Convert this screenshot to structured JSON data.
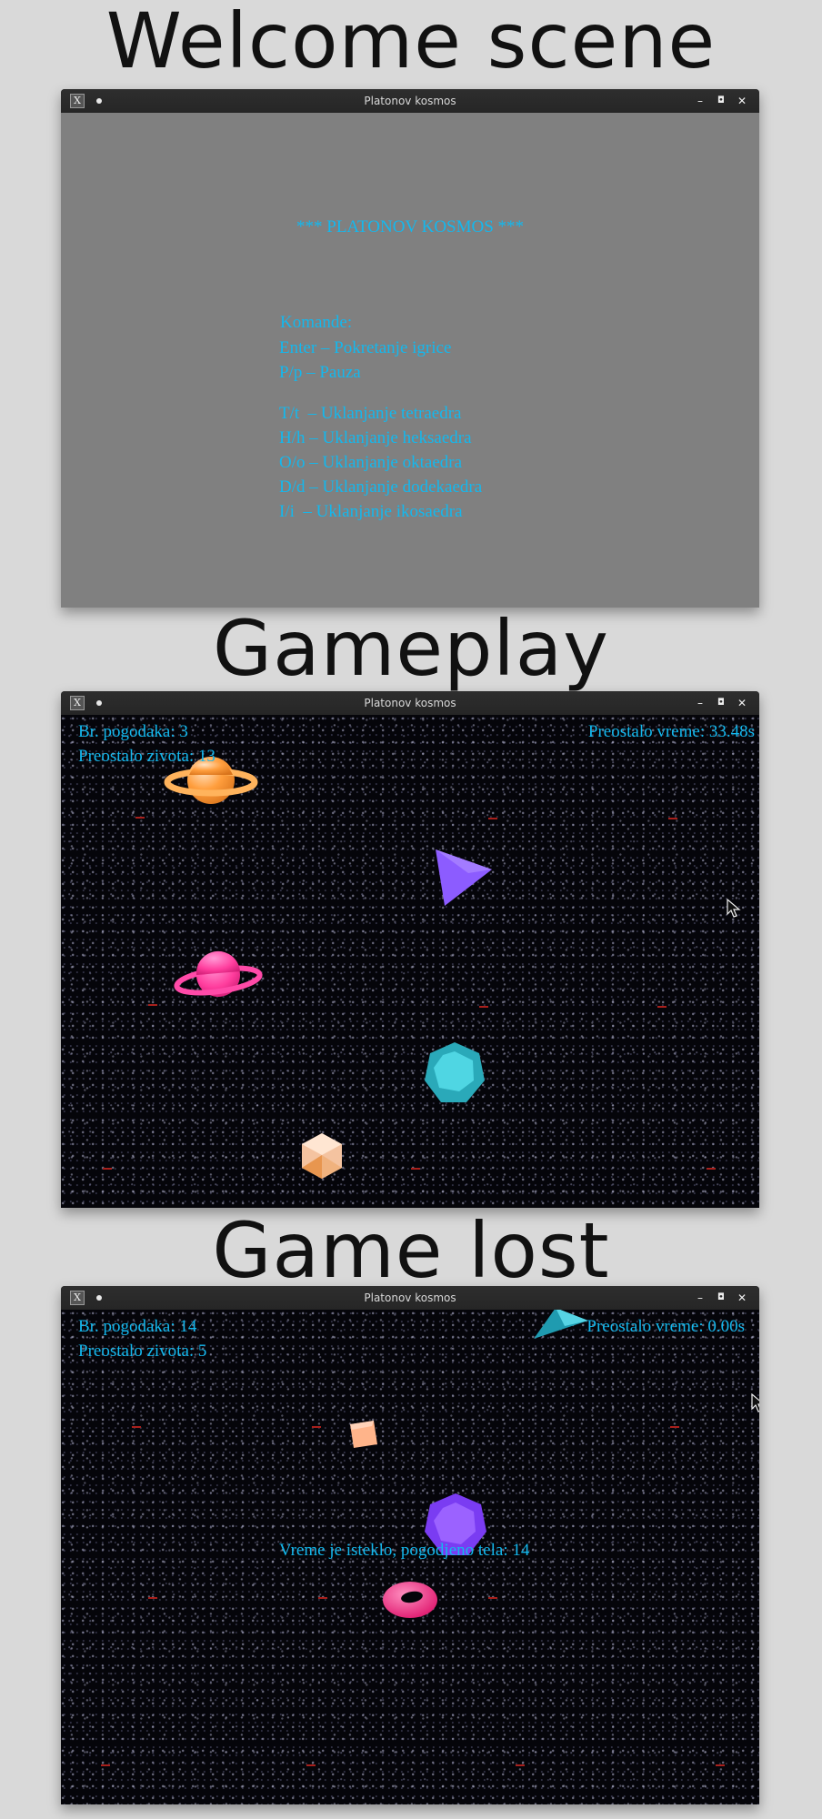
{
  "sections": {
    "welcome": "Welcome scene",
    "gameplay": "Gameplay",
    "lost": "Game lost"
  },
  "window": {
    "title": "Platonov kosmos",
    "app_icon": "X",
    "controls": {
      "minimize": "–",
      "maximize": "◘",
      "close": "✕"
    }
  },
  "welcome": {
    "heading": "*** PLATONOV KOSMOS ***",
    "commands_label": "Komande:",
    "commands": [
      "Enter – Pokretanje igrice",
      "P/p – Pauza"
    ],
    "removal_commands": [
      "T/t  – Uklanjanje tetraedra",
      "H/h – Uklanjanje heksaedra",
      "O/o – Uklanjanje oktaedra",
      "D/d – Uklanjanje dodekaedra",
      "I/i  – Uklanjanje ikosaedra"
    ],
    "colors": {
      "background": "#808080",
      "text": "#13b8ee"
    }
  },
  "gameplay": {
    "hits": "Br. pogodaka: 3",
    "lives": "Preostalo zivota: 13",
    "time_left": "Preostalo vreme: 33.48s",
    "objects": [
      "orange-ringed-planet",
      "purple-tetrahedron",
      "pink-ringed-planet",
      "cyan-dodecahedron",
      "peach-icosahedron"
    ]
  },
  "lost": {
    "hits": "Br. pogodaka: 14",
    "lives": "Preostalo zivota: 5",
    "time_left": "Preostalo vreme: 0.00s",
    "message": "Vreme je isteklo, pogodjeno tela: 14",
    "objects": [
      "cyan-tetrahedron",
      "peach-hexahedron",
      "purple-dodecahedron",
      "pink-torus"
    ]
  }
}
